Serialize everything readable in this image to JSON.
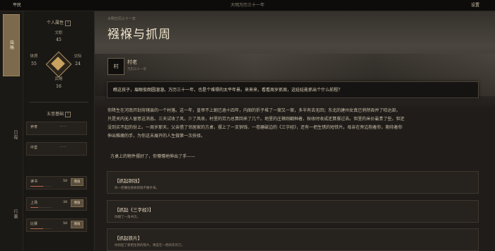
{
  "topbar": {
    "left": "平民",
    "center": "大明万历三十一年",
    "right": "设置"
  },
  "nav": {
    "items": [
      "简略",
      "日程",
      "行囊"
    ]
  },
  "status": {
    "personal_title": "个人属性",
    "help": "?",
    "stats": {
      "wen": {
        "label": "文职",
        "value": "45"
      },
      "ti": {
        "label": "体质",
        "value": "55"
      },
      "ren": {
        "label": "交际",
        "value": "24"
      },
      "wu": {
        "label": "武略",
        "value": "16"
      }
    },
    "condition_title": "五音基础",
    "cells": [
      {
        "name": "养育",
        "dash": "——",
        "value": "",
        "btn": "",
        "fill": 0.0
      },
      {
        "name": "中堂",
        "dash": "——",
        "value": "",
        "btn": "",
        "fill": 0.0
      },
      {
        "name": "读书",
        "dash": "",
        "value": "50",
        "btn": "增值",
        "fill": 0.6
      },
      {
        "name": "上场",
        "dash": "",
        "value": "30",
        "btn": "增值",
        "fill": 0.35
      },
      {
        "name": "比赛",
        "dash": "",
        "value": "50",
        "btn": "增值",
        "fill": 0.6
      }
    ]
  },
  "main": {
    "breadcrumb": "大明万历三十一年",
    "title": "襁褓与抓周",
    "avatar": "村",
    "speaker": "村老",
    "speaker_sub": "万历三十一年",
    "dialog": "瞧这孩子，眉眼俊朗圆溜溜。万历三十一年，也是个难得的太平年景。来来来，看看周岁抓周，这娃娃能抓出个什么前程？",
    "paragraphs": [
      "你降生在河南开封府辖县的一个村落。这一年，皇帝不上朝已逾十四年，内阁的折子堆了一案又一案，多半有去无回；东北的建州女真已悄然吞并了哈达部，",
      "只是关内无人留意这消息。三天试收了风，少了风收，村里的劳力总算回来了几个。地里的庄稼刚翻种着，秋收时收成还算撑过去。但里的米价最贵了些，但还",
      "没到买不起的份上。一周岁那天，父亲借了邻居家的方桌，摆上了一支铜钱、一卷磨破边的《三字经》，还有一把生锈的短铁片。母亲在旁边抱着你，期待着你",
      "伸出稚嫩的手，为你这未展开的人生做第一次抉择。"
    ],
    "prompt": "方桌上的物件摆好了，你懵懵地伸出了手——",
    "choices": [
      {
        "title": "【抓起铜钱】",
        "desc": "你一把攥住那枚铜钱不撒手来。"
      },
      {
        "title": "【抓起《三字经》】",
        "desc": "你翻了一角书页。"
      },
      {
        "title": "【抓起铁片】",
        "desc": "你抓起了那把生锈的铁片，像是在一把闲年的刀。"
      }
    ]
  },
  "colors": {
    "accent": "#c9a25f",
    "active_nav": "#7d6a4c",
    "bar": "#b36a4e"
  }
}
